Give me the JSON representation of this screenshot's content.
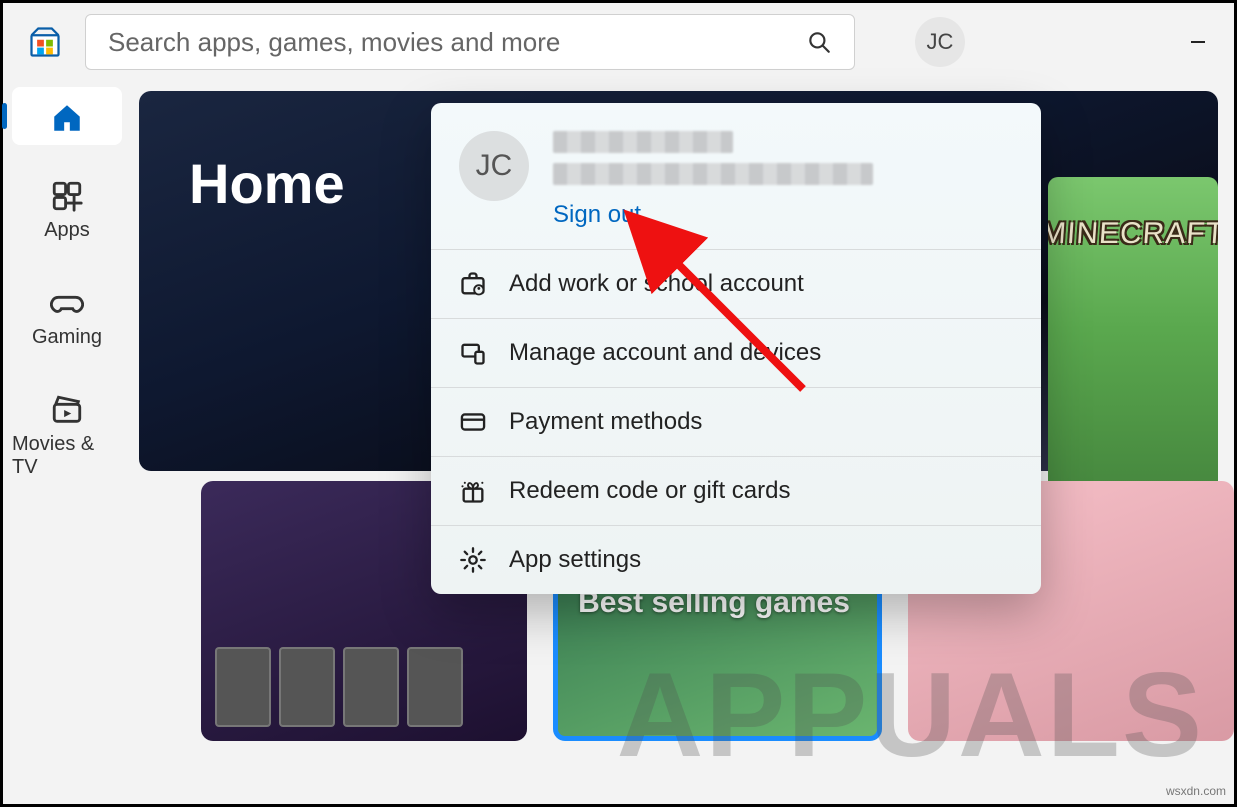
{
  "search": {
    "placeholder": "Search apps, games, movies and more"
  },
  "user": {
    "initials": "JC"
  },
  "nav": {
    "home": "",
    "apps": "Apps",
    "gaming": "Gaming",
    "movies": "Movies & TV"
  },
  "hero": {
    "title": "Home"
  },
  "cards": {
    "best_selling": "Best selling games"
  },
  "minecraft": {
    "logo": "MINECRAFT"
  },
  "flyout": {
    "signout": "Sign out",
    "items": [
      {
        "label": "Add work or school account"
      },
      {
        "label": "Manage account and devices"
      },
      {
        "label": "Payment methods"
      },
      {
        "label": "Redeem code or gift cards"
      },
      {
        "label": "App settings"
      }
    ]
  },
  "watermark": {
    "text": "APPUALS",
    "sub": "wsxdn.com"
  }
}
